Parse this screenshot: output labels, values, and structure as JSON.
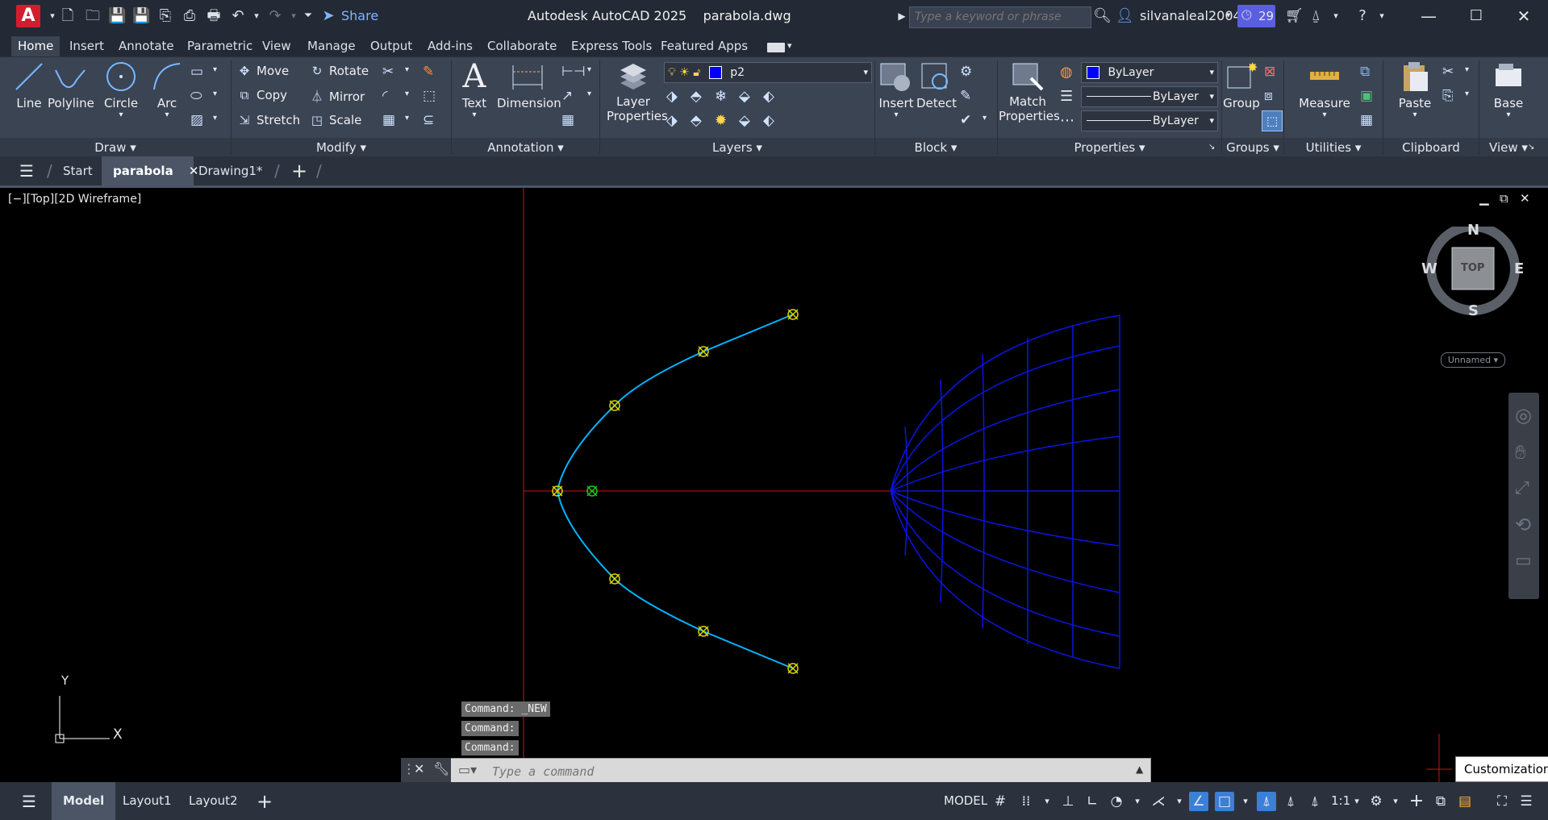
{
  "app": {
    "title": "Autodesk AutoCAD 2025",
    "filename": "parabola.dwg",
    "logo_letter": "A",
    "share_label": "Share"
  },
  "search": {
    "placeholder": "Type a keyword or phrase"
  },
  "user": {
    "name": "silvanaleal2004",
    "trial_count": "29"
  },
  "ribbon_tabs": [
    "Home",
    "Insert",
    "Annotate",
    "Parametric",
    "View",
    "Manage",
    "Output",
    "Add-ins",
    "Collaborate",
    "Express Tools",
    "Featured Apps"
  ],
  "active_ribbon_tab": "Home",
  "draw_panel": {
    "line": "Line",
    "polyline": "Polyline",
    "circle": "Circle",
    "arc": "Arc",
    "label": "Draw"
  },
  "modify_panel": {
    "move": "Move",
    "copy": "Copy",
    "stretch": "Stretch",
    "rotate": "Rotate",
    "mirror": "Mirror",
    "scale": "Scale",
    "label": "Modify"
  },
  "annotation_panel": {
    "text": "Text",
    "dimension": "Dimension",
    "label": "Annotation"
  },
  "layers_panel": {
    "layer_properties_1": "Layer",
    "layer_properties_2": "Properties",
    "current_layer": "p2",
    "label": "Layers",
    "layer_color": "#0000ff"
  },
  "block_panel": {
    "insert": "Insert",
    "detect": "Detect",
    "label": "Block"
  },
  "properties_panel": {
    "match_1": "Match",
    "match_2": "Properties",
    "color_value": "ByLayer",
    "linetype_value": "ByLayer",
    "lineweight_value": "ByLayer",
    "label": "Properties"
  },
  "groups_panel": {
    "group": "Group",
    "label": "Groups"
  },
  "utilities_panel": {
    "measure": "Measure",
    "label": "Utilities"
  },
  "clipboard_panel": {
    "paste": "Paste",
    "label": "Clipboard"
  },
  "view_panel": {
    "base": "Base",
    "label": "View"
  },
  "doc_tabs": {
    "start": "Start",
    "parabola": "parabola",
    "drawing1": "Drawing1*"
  },
  "viewport": {
    "label": "[−][Top][2D Wireframe]",
    "compass": {
      "n": "N",
      "s": "S",
      "e": "E",
      "w": "W",
      "top": "TOP"
    },
    "ucs_name": "Unnamed",
    "ucs_x": "X",
    "ucs_y": "Y"
  },
  "command_history": [
    "Command: _NEW",
    "Command:",
    "Command:"
  ],
  "command_input": {
    "placeholder": "Type a command"
  },
  "layout_tabs": {
    "model": "Model",
    "layout1": "Layout1",
    "layout2": "Layout2"
  },
  "status": {
    "model_label": "MODEL",
    "scale": "1:1"
  },
  "tooltip": {
    "text": "Customization"
  },
  "colors": {
    "accent": "#3c7fd6",
    "curve": "#00b4ff",
    "mesh": "#0a14e6",
    "axis": "#c81414",
    "grip": "#d7d700",
    "logo": "#d21d2f"
  }
}
